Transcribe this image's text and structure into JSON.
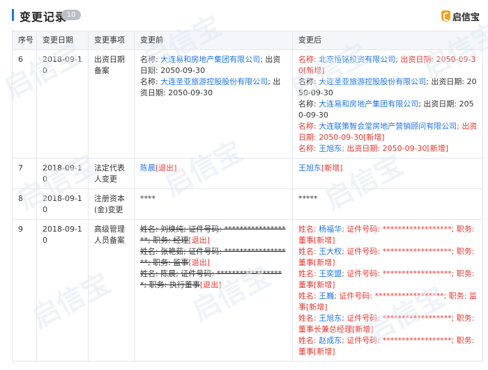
{
  "header": {
    "title": "变更记录",
    "count": "10",
    "brand": "启信宝"
  },
  "columns": [
    "序号",
    "变更日期",
    "变更事项",
    "变更前",
    "变更后"
  ],
  "rows": [
    {
      "no": "6",
      "date": "2018-09-10",
      "item": "出资日期备案",
      "before": [
        [
          {
            "t": "名称: "
          },
          {
            "t": "大连易和房地产集团有限公司",
            "c": "blue"
          },
          {
            "t": "; 出资日期: 2050-09-30"
          }
        ],
        [
          {
            "t": "名称: "
          },
          {
            "t": "大连圣亚旅游控股股份有限公司",
            "c": "blue"
          },
          {
            "t": "; 出资日期: 2050-09-30"
          }
        ]
      ],
      "after": [
        [
          {
            "t": "名称: ",
            "c": "red"
          },
          {
            "t": "北京恒铭投资有限公司",
            "c": "blue"
          },
          {
            "t": "; 出资日期: 2050-09-30[新增]",
            "c": "red"
          }
        ],
        [
          {
            "t": "名称: "
          },
          {
            "t": "大连圣亚旅游控股股份有限公司",
            "c": "blue"
          },
          {
            "t": "; 出资日期: 2050-09-30"
          }
        ],
        [
          {
            "t": "名称: "
          },
          {
            "t": "大连易和房地产集团有限公司",
            "c": "blue"
          },
          {
            "t": "; 出资日期: 2050-09-30"
          }
        ],
        [
          {
            "t": "名称: ",
            "c": "red"
          },
          {
            "t": "大连联策智会堂房地产营销顾问有限公司",
            "c": "blue"
          },
          {
            "t": "; 出资日期: 2050-09-30[新增]",
            "c": "red"
          }
        ],
        [
          {
            "t": "名称: ",
            "c": "red"
          },
          {
            "t": "王旭东",
            "c": "blue"
          },
          {
            "t": "; 出资日期: 2050-09-30[新增]",
            "c": "red"
          }
        ]
      ]
    },
    {
      "no": "7",
      "date": "2018-09-10",
      "item": "法定代表人变更",
      "before": [
        [
          {
            "t": "陈晨",
            "c": "blue"
          },
          {
            "t": "[退出]",
            "c": "red"
          }
        ]
      ],
      "after": [
        [
          {
            "t": "王旭东",
            "c": "blue"
          },
          {
            "t": "[新增]",
            "c": "red"
          }
        ]
      ]
    },
    {
      "no": "8",
      "date": "2018-09-10",
      "item": "注册资本(金)变更",
      "before": [
        [
          {
            "t": "****"
          }
        ]
      ],
      "after": [
        [
          {
            "t": "*****"
          }
        ]
      ]
    },
    {
      "no": "9",
      "date": "2018-09-10",
      "item": "高级管理人员备案",
      "before": [
        [
          {
            "t": "姓名: ",
            "c": "strike"
          },
          {
            "t": "刘焕纯",
            "c": "blue strike"
          },
          {
            "t": "; 证件号码: ******************; 职务: 经理",
            "c": "strike"
          },
          {
            "t": "[退出]",
            "c": "red"
          }
        ],
        [
          {
            "t": "姓名: ",
            "c": "strike"
          },
          {
            "t": "张艳茹",
            "c": "blue strike"
          },
          {
            "t": "; 证件号码: ******************; 职务: 监事",
            "c": "strike"
          },
          {
            "t": "[退出]",
            "c": "red"
          }
        ],
        [
          {
            "t": "姓名: ",
            "c": "strike"
          },
          {
            "t": "陈晨",
            "c": "blue strike"
          },
          {
            "t": "; 证件号码: ******************; 职务: 执行董事",
            "c": "strike"
          },
          {
            "t": "[退出]",
            "c": "red"
          }
        ]
      ],
      "after": [
        [
          {
            "t": "姓名: ",
            "c": "red"
          },
          {
            "t": "杨福华",
            "c": "blue"
          },
          {
            "t": "; 证件号码: ******************; 职务: 董事[新增]",
            "c": "red"
          }
        ],
        [
          {
            "t": "姓名: ",
            "c": "red"
          },
          {
            "t": "王大权",
            "c": "blue"
          },
          {
            "t": "; 证件号码: ******************; 职务: 董事[新增]",
            "c": "red"
          }
        ],
        [
          {
            "t": "姓名: ",
            "c": "red"
          },
          {
            "t": "王奕盟",
            "c": "blue"
          },
          {
            "t": "; 证件号码: ******************; 职务: 董事[新增]",
            "c": "red"
          }
        ],
        [
          {
            "t": "姓名: ",
            "c": "red"
          },
          {
            "t": "王巍",
            "c": "blue"
          },
          {
            "t": "; 证件号码: ******************; 职务: 监事[新增]",
            "c": "red"
          }
        ],
        [
          {
            "t": "姓名: ",
            "c": "red"
          },
          {
            "t": "王旭东",
            "c": "blue"
          },
          {
            "t": "; 证件号码: ******************; 职务: 董事长兼总经理[新增]",
            "c": "red"
          }
        ],
        [
          {
            "t": "姓名: ",
            "c": "red"
          },
          {
            "t": "赵成东",
            "c": "blue"
          },
          {
            "t": "; 证件号码: ******************; 职务: 董事[新增]",
            "c": "red"
          }
        ]
      ]
    }
  ],
  "watermark_text": "启信宝"
}
